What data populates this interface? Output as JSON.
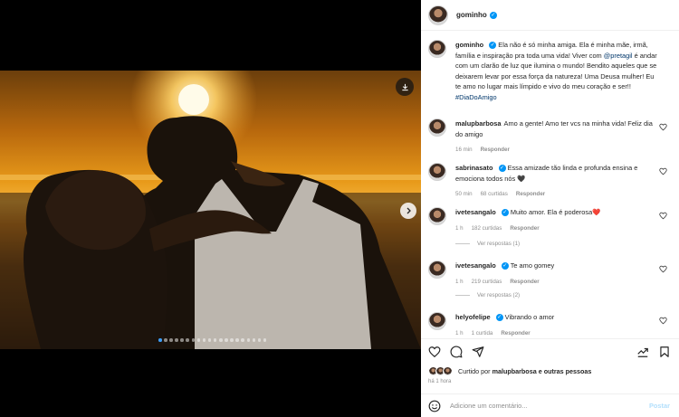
{
  "colors": {
    "accent": "#0095f6",
    "link": "#00376b",
    "muted": "#8e8e8e",
    "like_red": "#ed4956"
  },
  "post": {
    "username": "gominho",
    "caption_prefix": "Ela não é só minha amiga. Ela é minha mãe, irmã, família e inspiração pra toda uma vida! Viver com ",
    "caption_mention": "@pretagil",
    "caption_middle": " é andar com um clarão de luz que ilumina o mundo! Bendito aqueles que se deixarem levar por essa força da natureza! Uma Deusa mulher! Eu te amo no lugar mais límpido e vivo do meu coração e ser!! ",
    "caption_hashtag": "#DiaDoAmigo",
    "carousel": {
      "count": 20,
      "active_index": 0
    }
  },
  "comments": [
    {
      "username": "malupbarbosa",
      "verified": false,
      "text": "Amo a gente! Amo ter vcs na minha vida! Feliz dia do amigo",
      "time": "16 min",
      "likes": "",
      "reply": "Responder"
    },
    {
      "username": "sabrinasato",
      "verified": true,
      "text": "Essa amizade tão linda e profunda ensina e emociona todos nós 🖤",
      "time": "50 min",
      "likes": "68 curtidas",
      "reply": "Responder"
    },
    {
      "username": "ivetesangalo",
      "verified": true,
      "text": "Muito amor. Ela é poderosa❤️",
      "time": "1 h",
      "likes": "182 curtidas",
      "reply": "Responder",
      "view_replies": "Ver respostas (1)"
    },
    {
      "username": "ivetesangalo",
      "verified": true,
      "text": "Te amo gomey",
      "time": "1 h",
      "likes": "219 curtidas",
      "reply": "Responder",
      "view_replies": "Ver respostas (2)"
    },
    {
      "username": "helyofelipe",
      "verified": true,
      "text": "Vibrando o amor",
      "time": "1 h",
      "likes": "1 curtida",
      "reply": "Responder"
    }
  ],
  "liked_by": {
    "prefix": "Curtido por ",
    "user": "malupbarbosa",
    "suffix": " e outras pessoas"
  },
  "time_ago": "há 1 hora",
  "add_comment": {
    "placeholder": "Adicione um comentário...",
    "post_label": "Postar"
  },
  "icons": [
    "download-icon",
    "chevron-right-icon",
    "heart-icon",
    "comment-icon",
    "share-icon",
    "stats-icon",
    "bookmark-icon",
    "emoji-icon",
    "verified-icon"
  ]
}
